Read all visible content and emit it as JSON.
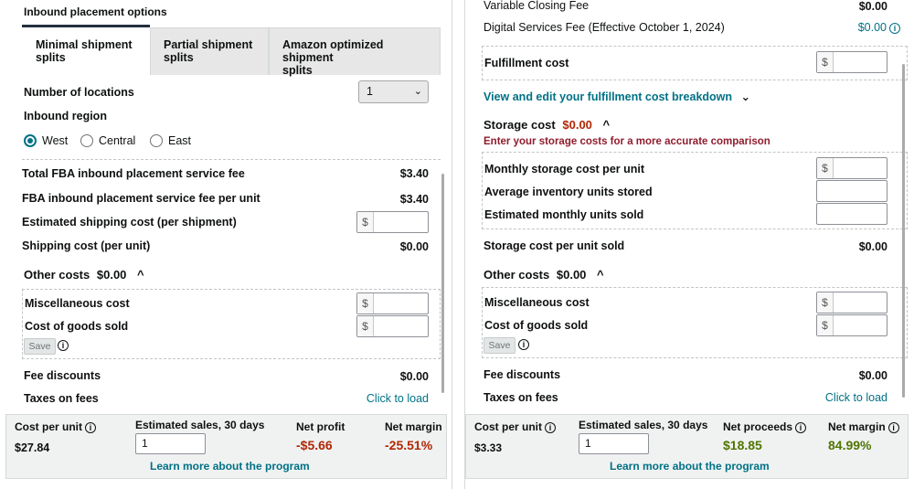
{
  "left": {
    "section_title": "Inbound placement options",
    "tabs": [
      "Minimal shipment splits",
      "Partial shipment splits",
      "Amazon optimized shipment splits"
    ],
    "tab_lines": [
      [
        "Minimal shipment",
        "splits"
      ],
      [
        "Partial shipment",
        "splits"
      ],
      [
        "Amazon optimized shipment",
        "splits"
      ]
    ],
    "number_of_locations_label": "Number of locations",
    "number_of_locations_value": "1",
    "inbound_region_label": "Inbound region",
    "regions": [
      "West",
      "Central",
      "East"
    ],
    "selected_region": "West",
    "total_fee_label": "Total FBA inbound placement service fee",
    "total_fee_value": "$3.40",
    "per_unit_fee_label": "FBA inbound placement service fee per unit",
    "per_unit_fee_value": "$3.40",
    "est_shipping_label": "Estimated shipping cost (per shipment)",
    "shipping_per_unit_label": "Shipping cost (per unit)",
    "shipping_per_unit_value": "$0.00",
    "other_costs_label": "Other costs",
    "other_costs_value": "$0.00",
    "misc_label": "Miscellaneous cost",
    "cogs_label": "Cost of goods sold",
    "save_label": "Save",
    "fee_discounts_label": "Fee discounts",
    "fee_discounts_value": "$0.00",
    "taxes_label": "Taxes on fees",
    "taxes_value": "Click to load",
    "footer": {
      "cost_per_unit_label": "Cost per unit",
      "cost_per_unit_value": "$27.84",
      "est_sales_label": "Estimated sales, 30 days",
      "est_sales_value": "1",
      "net_label": "Net profit",
      "net_value": "-$5.66",
      "margin_label": "Net margin",
      "margin_value": "-25.51%",
      "learn_more": "Learn more about the program"
    }
  },
  "right": {
    "variable_closing_label": "Variable Closing Fee",
    "variable_closing_value": "$0.00",
    "digital_services_label": "Digital Services Fee (Effective October 1, 2024)",
    "digital_services_value": "$0.00",
    "fulfillment_label": "Fulfillment cost",
    "view_edit_link": "View and edit your fulfillment cost breakdown",
    "storage_label": "Storage cost",
    "storage_value": "$0.00",
    "storage_hint": "Enter your storage costs for a more accurate comparison",
    "monthly_storage_label": "Monthly storage cost per unit",
    "avg_inventory_label": "Average inventory units stored",
    "est_monthly_sold_label": "Estimated monthly units sold",
    "storage_per_unit_label": "Storage cost per unit sold",
    "storage_per_unit_value": "$0.00",
    "other_costs_label": "Other costs",
    "other_costs_value": "$0.00",
    "misc_label": "Miscellaneous cost",
    "cogs_label": "Cost of goods sold",
    "save_label": "Save",
    "fee_discounts_label": "Fee discounts",
    "fee_discounts_value": "$0.00",
    "taxes_label": "Taxes on fees",
    "taxes_value": "Click to load",
    "footer": {
      "cost_per_unit_label": "Cost per unit",
      "cost_per_unit_value": "$3.33",
      "est_sales_label": "Estimated sales, 30 days",
      "est_sales_value": "1",
      "net_label": "Net proceeds",
      "net_value": "$18.85",
      "margin_label": "Net margin",
      "margin_value": "84.99%",
      "learn_more": "Learn more about the program"
    }
  },
  "currency_symbol": "$",
  "icons": {
    "chevron_up": "^",
    "chevron_down": "⌄",
    "info": "i"
  },
  "colors": {
    "link": "#007185",
    "negative": "#b12704",
    "positive": "#507500",
    "tab_inactive": "#e7e7e7",
    "footer_bg": "#f0f2f2"
  }
}
